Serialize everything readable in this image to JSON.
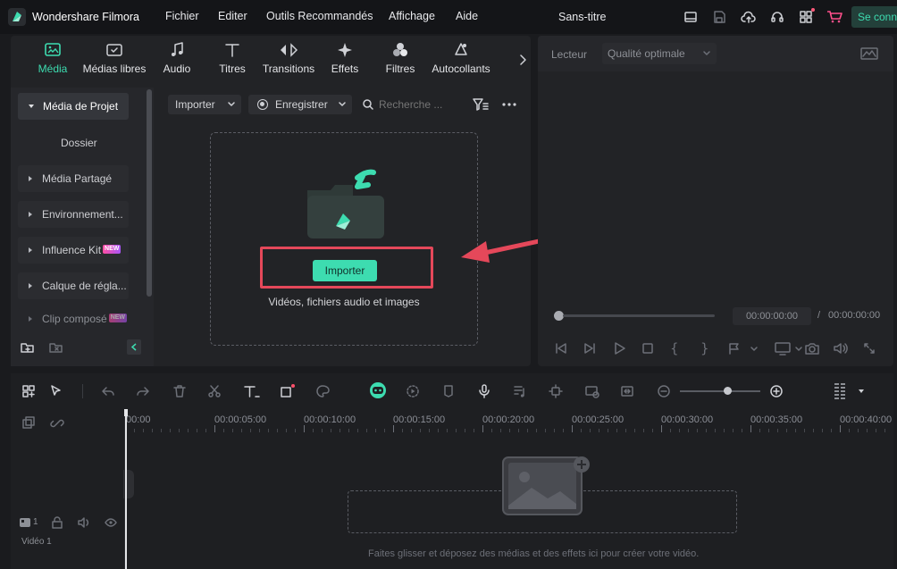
{
  "app": {
    "name": "Wondershare Filmora",
    "project_title": "Sans-titre",
    "menus": [
      "Fichier",
      "Editer",
      "Outils Recommandés",
      "Affichage",
      "Aide"
    ],
    "connect_label": "Se conn"
  },
  "tool_tabs": [
    {
      "label": "Média",
      "icon": "media-icon",
      "active": true
    },
    {
      "label": "Médias libres",
      "icon": "stock-media-icon"
    },
    {
      "label": "Audio",
      "icon": "music-note-icon"
    },
    {
      "label": "Titres",
      "icon": "text-t-icon"
    },
    {
      "label": "Transitions",
      "icon": "transition-arrows-icon"
    },
    {
      "label": "Effets",
      "icon": "sparkle-icon"
    },
    {
      "label": "Filtres",
      "icon": "filter-circles-icon"
    },
    {
      "label": "Autocollants",
      "icon": "sticker-icon"
    }
  ],
  "sidebar": {
    "items": [
      {
        "label": "Média de Projet",
        "active": true
      },
      {
        "label": "Dossier"
      },
      {
        "label": "Média Partagé"
      },
      {
        "label": "Environnement..."
      },
      {
        "label": "Influence Kit",
        "badge": "NEW"
      },
      {
        "label": "Calque de régla..."
      },
      {
        "label": "Clip composé",
        "badge": "NEW"
      }
    ]
  },
  "media_toolbar": {
    "import_label": "Importer",
    "record_label": "Enregistrer",
    "search_placeholder": "Recherche ..."
  },
  "drop_zone": {
    "import_button": "Importer",
    "hint": "Vidéos, fichiers audio et images"
  },
  "player": {
    "label": "Lecteur",
    "quality": "Qualité optimale",
    "current_time": "00:00:00:00",
    "separator": "/",
    "total_time": "00:00:00:00"
  },
  "timeline": {
    "ruler": [
      "00:00",
      "00:00:05:00",
      "00:00:10:00",
      "00:00:15:00",
      "00:00:20:00",
      "00:00:25:00",
      "00:00:30:00",
      "00:00:35:00",
      "00:00:40:00"
    ],
    "track_label": "Vidéo 1",
    "track_number": "1",
    "drop_hint": "Faites glisser et déposez des médias et des effets ici pour créer votre vidéo.",
    "zoom_level": 0.6
  },
  "colors": {
    "accent": "#3ddcb0",
    "highlight_box": "#e5485a",
    "background": "#1a1b1e",
    "panel": "#222326"
  }
}
